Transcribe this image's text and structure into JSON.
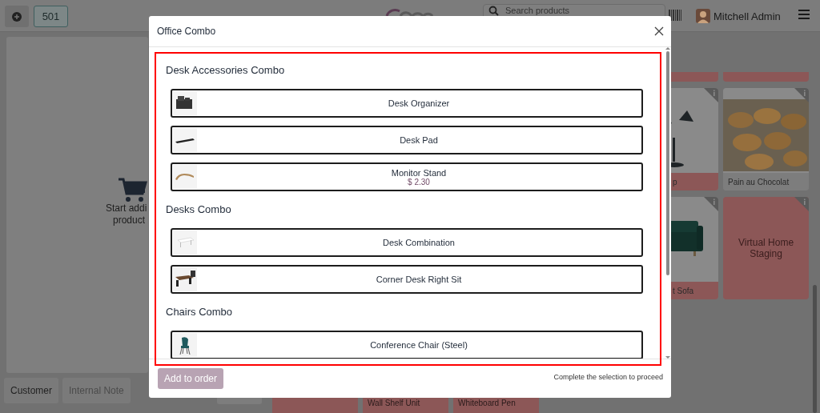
{
  "topbar": {
    "table_number": "501",
    "search": {
      "placeholder": "Search products"
    },
    "user": "Mitchell Admin"
  },
  "order": {
    "empty_lines": [
      "Start addi",
      "product"
    ],
    "buttons": [
      {
        "label": "Customer",
        "disabled": false
      },
      {
        "label": "Internal Note",
        "disabled": true
      }
    ]
  },
  "products": {
    "top_strips": [
      {
        "color": "#8c5757"
      },
      {
        "color": "#8c5757"
      }
    ],
    "rows": [
      [
        {
          "name": "p",
          "color": "#8c5757"
        },
        {
          "name": "Pain au Chocolat",
          "color": "#7d7d7d"
        }
      ],
      [
        {
          "name": "t Sofa",
          "color": "#8c5757"
        },
        {
          "kind": "text",
          "name": "Virtual Home Staging",
          "color": "#8c5757"
        }
      ]
    ],
    "bottom_cards": [
      {
        "color": "#8c5757"
      },
      {
        "name": "Wall Shelf Unit",
        "color": "#8c5757"
      },
      {
        "name": "Whiteboard Pen",
        "color": "#8c5757"
      }
    ]
  },
  "dialog": {
    "title": "Office Combo",
    "sections": [
      {
        "title": "Desk Accessories Combo",
        "items": [
          {
            "name": "Desk Organizer"
          },
          {
            "name": "Desk Pad"
          },
          {
            "name": "Monitor Stand",
            "price": "$ 2.30"
          }
        ]
      },
      {
        "title": "Desks Combo",
        "items": [
          {
            "name": "Desk Combination"
          },
          {
            "name": "Corner Desk Right Sit"
          }
        ]
      },
      {
        "title": "Chairs Combo",
        "items": [
          {
            "name": "Conference Chair (Steel)"
          }
        ]
      }
    ],
    "add_button": {
      "label": "Add to order",
      "disabled": true
    },
    "hint": "Complete the selection to proceed"
  }
}
